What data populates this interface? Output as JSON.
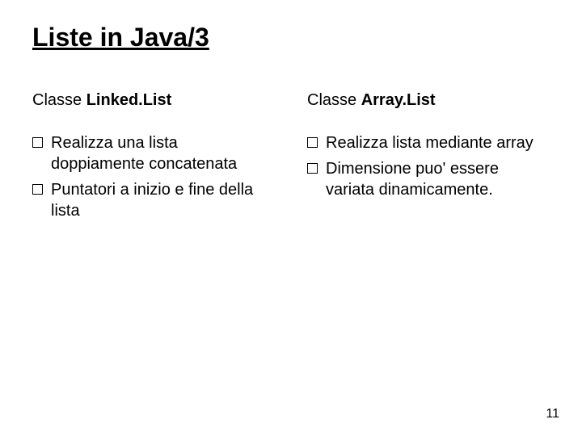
{
  "title": "Liste in Java/3",
  "left": {
    "heading_plain": "Classe ",
    "heading_bold": "Linked.List",
    "items": [
      "Realizza una lista doppiamente concatenata",
      "Puntatori a inizio e fine della lista"
    ]
  },
  "right": {
    "heading_plain": "Classe ",
    "heading_bold": "Array.List",
    "items": [
      "Realizza lista mediante array",
      "Dimensione puo' essere variata dinamicamente."
    ]
  },
  "page_number": "11"
}
